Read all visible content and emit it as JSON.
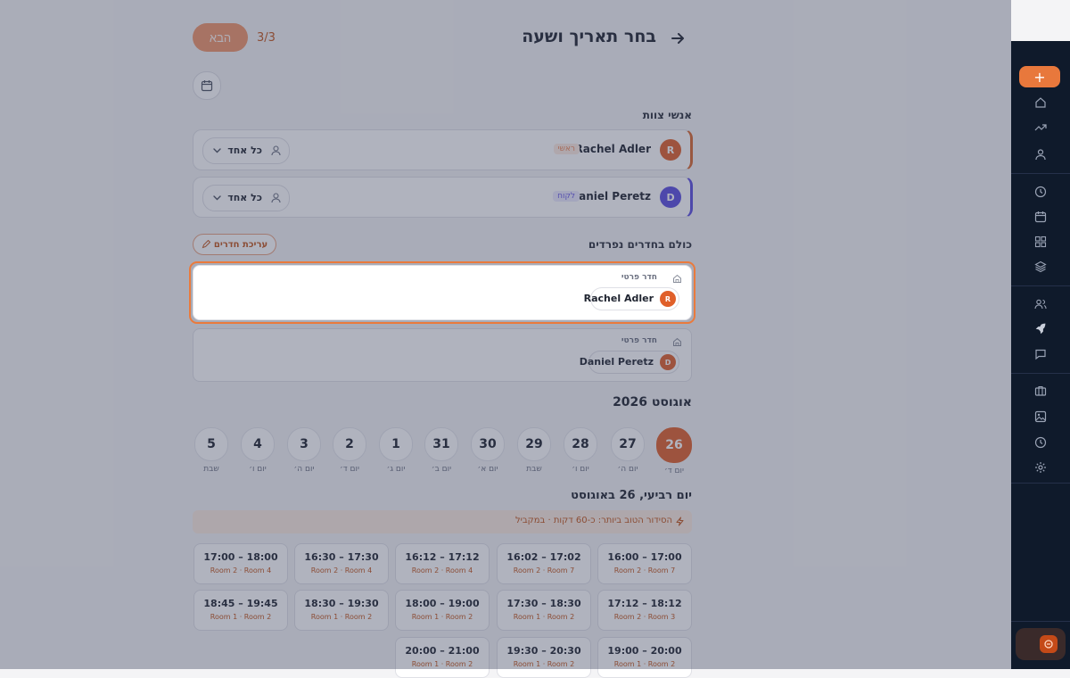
{
  "header": {
    "title": "בחר תאריך ושעה",
    "step": "3/3",
    "next_label": "הבא"
  },
  "staff": {
    "section_label": "אנשי צוות",
    "members": [
      {
        "initial": "R",
        "name": "Rachel Adler",
        "role": "ראשי",
        "scope": "כל אחד",
        "color": "#e0602a",
        "role_color": "#f08a5d",
        "role_bg": "#fdebe1"
      },
      {
        "initial": "D",
        "name": "Daniel Peretz",
        "role": "לקוח",
        "scope": "כל אחד",
        "color": "#5b4ee0",
        "role_color": "#6a5ce6",
        "role_bg": "#ece9fd"
      }
    ]
  },
  "rooms": {
    "section_label": "כולם בחדרים נפרדים",
    "edit_label": "עריכת חדרים",
    "items": [
      {
        "title": "חדר פרטי",
        "person_initial": "R",
        "person": "Rachel Adler"
      },
      {
        "title": "חדר פרטי",
        "person_initial": "D",
        "person": "Daniel Peretz"
      }
    ]
  },
  "calendar": {
    "month": "אוגוסט 2026",
    "days": [
      {
        "num": "26",
        "name": "יום ד׳",
        "selected": true
      },
      {
        "num": "27",
        "name": "יום ה׳"
      },
      {
        "num": "28",
        "name": "יום ו׳"
      },
      {
        "num": "29",
        "name": "שבת"
      },
      {
        "num": "30",
        "name": "יום א׳"
      },
      {
        "num": "31",
        "name": "יום ב׳"
      },
      {
        "num": "1",
        "name": "יום ג׳"
      },
      {
        "num": "2",
        "name": "יום ד׳"
      },
      {
        "num": "3",
        "name": "יום ה׳"
      },
      {
        "num": "4",
        "name": "יום ו׳"
      },
      {
        "num": "5",
        "name": "שבת"
      }
    ],
    "day_heading": "יום רביעי, 26 באוגוסט",
    "banner": "הסידור הטוב ביותר: כ-60 דקות · במקביל"
  },
  "slots": [
    {
      "time": "16:00 – 17:00",
      "rooms": "Room 2 · Room 7"
    },
    {
      "time": "16:02 – 17:02",
      "rooms": "Room 2 · Room 7"
    },
    {
      "time": "16:12 – 17:12",
      "rooms": "Room 2 · Room 4"
    },
    {
      "time": "16:30 – 17:30",
      "rooms": "Room 2 · Room 4"
    },
    {
      "time": "17:00 – 18:00",
      "rooms": "Room 2 · Room 4"
    },
    {
      "time": "17:12 – 18:12",
      "rooms": "Room 2 · Room 3"
    },
    {
      "time": "17:30 – 18:30",
      "rooms": "Room 1 · Room 2"
    },
    {
      "time": "18:00 – 19:00",
      "rooms": "Room 1 · Room 2"
    },
    {
      "time": "18:30 – 19:30",
      "rooms": "Room 1 · Room 2"
    },
    {
      "time": "18:45 – 19:45",
      "rooms": "Room 1 · Room 2"
    },
    {
      "time": "19:00 – 20:00",
      "rooms": "Room 1 · Room 2"
    },
    {
      "time": "19:30 – 20:30",
      "rooms": "Room 1 · Room 2"
    },
    {
      "time": "20:00 – 21:00",
      "rooms": "Room 1 · Room 2"
    }
  ],
  "sidebar": {
    "add_label": "+",
    "icons": [
      "home-icon",
      "trending-icon",
      "user-icon",
      "clock-icon",
      "calendar-icon",
      "grid-icon",
      "layers-icon",
      "users-icon",
      "rocket-icon",
      "message-icon",
      "briefcase-icon",
      "image-icon",
      "history-icon",
      "settings-icon"
    ]
  },
  "colors": {
    "accent": "#e0602a",
    "secondary": "#5b4ee0",
    "sidebar": "#0f1a2b"
  }
}
